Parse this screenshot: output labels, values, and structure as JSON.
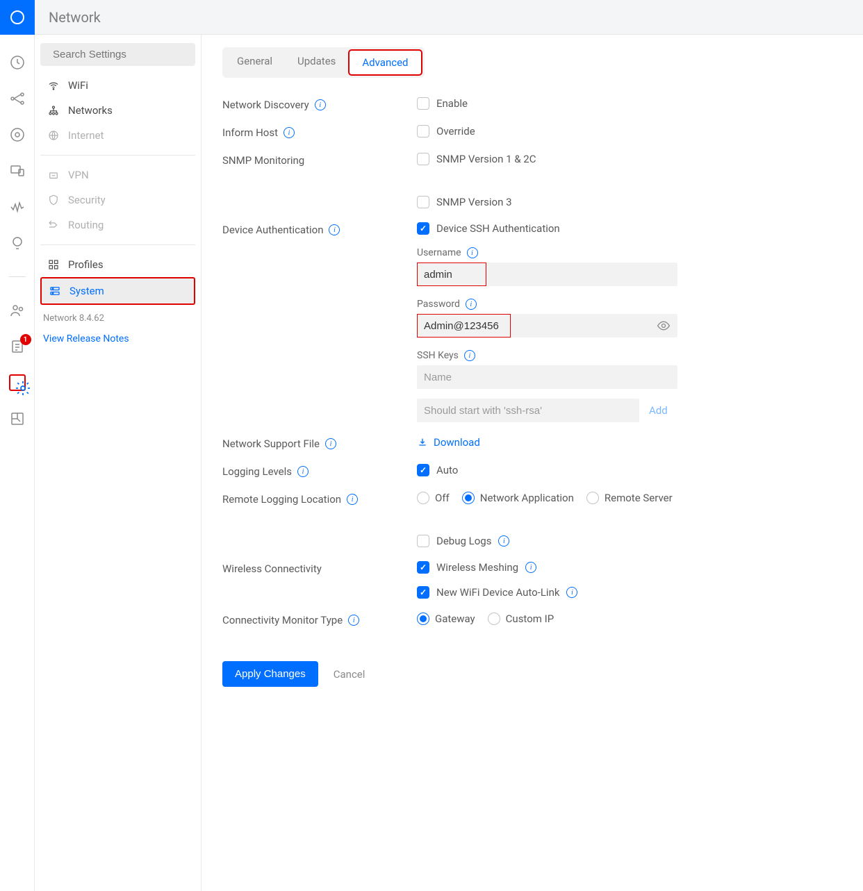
{
  "header": {
    "title": "Network"
  },
  "rail": {
    "badge": "1"
  },
  "search": {
    "placeholder": "Search Settings"
  },
  "sidebar": {
    "items": [
      {
        "label": "WiFi"
      },
      {
        "label": "Networks"
      },
      {
        "label": "Internet"
      },
      {
        "label": "VPN"
      },
      {
        "label": "Security"
      },
      {
        "label": "Routing"
      },
      {
        "label": "Profiles"
      },
      {
        "label": "System"
      }
    ],
    "version": "Network 8.4.62",
    "release_notes": "View Release Notes"
  },
  "tabs": {
    "general": "General",
    "updates": "Updates",
    "advanced": "Advanced"
  },
  "settings": {
    "network_discovery": {
      "label": "Network Discovery",
      "option": "Enable"
    },
    "inform_host": {
      "label": "Inform Host",
      "option": "Override"
    },
    "snmp": {
      "label": "SNMP Monitoring",
      "v12c": "SNMP Version 1 & 2C",
      "v3": "SNMP Version 3"
    },
    "device_auth": {
      "label": "Device Authentication",
      "ssh": "Device SSH Authentication",
      "username_label": "Username",
      "username_value": "admin",
      "password_label": "Password",
      "password_value": "Admin@123456",
      "sshkeys_label": "SSH Keys",
      "sshkeys_name_placeholder": "Name",
      "sshkeys_key_placeholder": "Should start with 'ssh-rsa'",
      "add": "Add"
    },
    "support_file": {
      "label": "Network Support File",
      "download": "Download"
    },
    "logging_levels": {
      "label": "Logging Levels",
      "auto": "Auto"
    },
    "remote_logging": {
      "label": "Remote Logging Location",
      "off": "Off",
      "app": "Network Application",
      "remote": "Remote Server",
      "debug": "Debug Logs"
    },
    "wireless": {
      "label": "Wireless Connectivity",
      "meshing": "Wireless Meshing",
      "autolink": "New WiFi Device Auto-Link"
    },
    "conn_monitor": {
      "label": "Connectivity Monitor Type",
      "gateway": "Gateway",
      "custom": "Custom IP"
    }
  },
  "actions": {
    "apply": "Apply Changes",
    "cancel": "Cancel"
  }
}
